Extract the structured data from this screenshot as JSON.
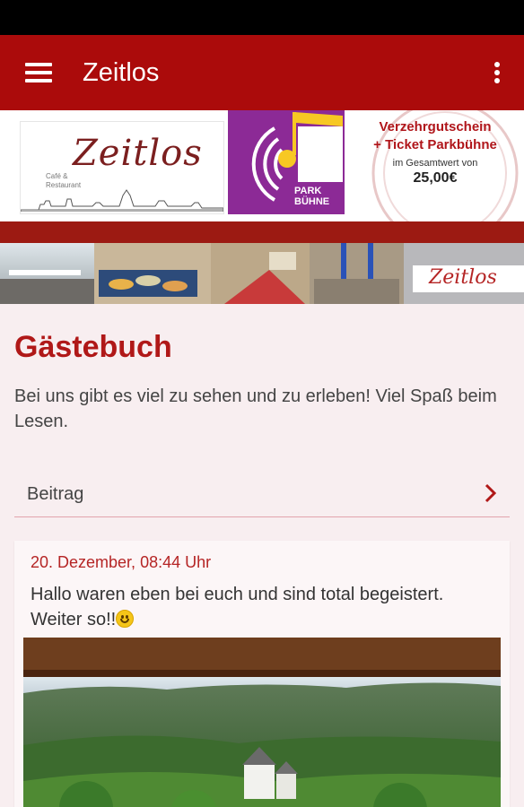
{
  "app_bar": {
    "title": "Zeitlos",
    "menu_icon": "hamburger-menu-icon",
    "overflow_icon": "more-vertical-icon",
    "color": "#ab0b0b"
  },
  "banner": {
    "logo_text": "Zeitlos",
    "logo_subtitle_1": "Café &",
    "logo_subtitle_2": "Restaurant",
    "park_label_1": "PARK",
    "park_label_2": "BÜHNE",
    "voucher_line_1": "Verzehrgutschein",
    "voucher_line_2": "+ Ticket Parkbühne",
    "voucher_line_3": "im Gesamtwert von",
    "voucher_price": "25,00€"
  },
  "page": {
    "title": "Gästebuch",
    "intro": "Bei uns gibt es viel zu sehen und zu erleben! Viel Spaß beim Lesen."
  },
  "beitrag": {
    "label": "Beitrag",
    "chevron_icon": "chevron-right-icon"
  },
  "entries": [
    {
      "date": "20. Dezember, 08:44 Uhr",
      "text": "Hallo waren eben bei euch und sind total begeistert. Weiter so!!",
      "emoji": "smiley-icon",
      "photo": "forest-castle-photo"
    }
  ],
  "colors": {
    "accent": "#ab0b0b",
    "title_red": "#b01818",
    "background": "#f8eef0"
  }
}
